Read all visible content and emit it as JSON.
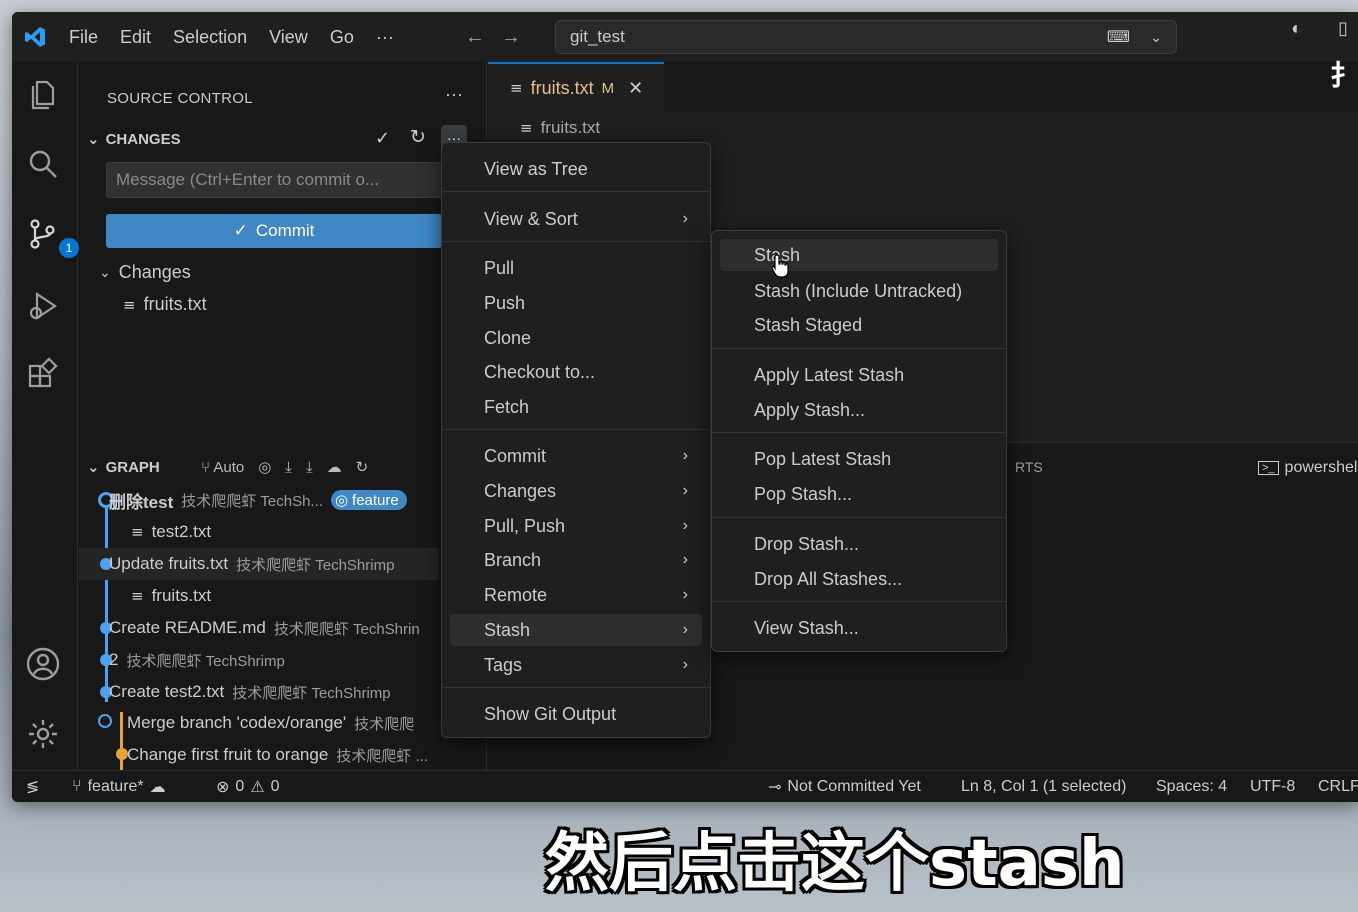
{
  "titlebar": {
    "menus": [
      "File",
      "Edit",
      "Selection",
      "View",
      "Go",
      "···"
    ],
    "search_text": "git_test"
  },
  "activity": {
    "scm_badge": "1"
  },
  "sidebar": {
    "title": "SOURCE CONTROL",
    "dots": "···",
    "changes_header": "CHANGES",
    "commit_placeholder": "Message (Ctrl+Enter to commit o...",
    "commit_label": "Commit",
    "changes_group": "Changes",
    "changed_file": "fruits.txt",
    "graph_header": "GRAPH",
    "graph_auto": "Auto",
    "graph": [
      {
        "message": "删除test",
        "author": "技术爬爬虾 TechSh...",
        "badge": "feature"
      },
      {
        "message": "test2.txt",
        "author": ""
      },
      {
        "message": "Update fruits.txt",
        "author": "技术爬爬虾 TechShrimp"
      },
      {
        "message": "fruits.txt",
        "author": ""
      },
      {
        "message": "Create README.md",
        "author": "技术爬爬虾 TechShrin"
      },
      {
        "message": "2",
        "author": "技术爬爬虾 TechShrimp"
      },
      {
        "message": "Create test2.txt",
        "author": "技术爬爬虾 TechShrimp"
      },
      {
        "message": "Merge branch 'codex/orange'",
        "author": "技术爬爬"
      },
      {
        "message": "Change first fruit to orange",
        "author": "技术爬爬虾 ..."
      }
    ]
  },
  "editor": {
    "tab_label": "fruits.txt",
    "tab_modified": "M",
    "breadcrumb": "fruits.txt",
    "panel_label": "RTS",
    "panel_terminal": "powershel"
  },
  "main_menu": {
    "items": [
      "View as Tree",
      "View & Sort",
      "Pull",
      "Push",
      "Clone",
      "Checkout to...",
      "Fetch",
      "Commit",
      "Changes",
      "Pull, Push",
      "Branch",
      "Remote",
      "Stash",
      "Tags",
      "Show Git Output"
    ]
  },
  "stash_menu": {
    "items": [
      "Stash",
      "Stash (Include Untracked)",
      "Stash Staged",
      "Apply Latest Stash",
      "Apply Stash...",
      "Pop Latest Stash",
      "Pop Stash...",
      "Drop Stash...",
      "Drop All Stashes...",
      "View Stash..."
    ]
  },
  "statusbar": {
    "branch": "feature*",
    "errors": "0",
    "warnings": "0",
    "commit_status": "Not Committed Yet",
    "position": "Ln 8, Col 1 (1 selected)",
    "spaces": "Spaces: 4",
    "encoding": "UTF-8",
    "eol": "CRLF"
  },
  "overlay": {
    "subtitle": "然后点击这个stash",
    "side_char": "扌"
  }
}
